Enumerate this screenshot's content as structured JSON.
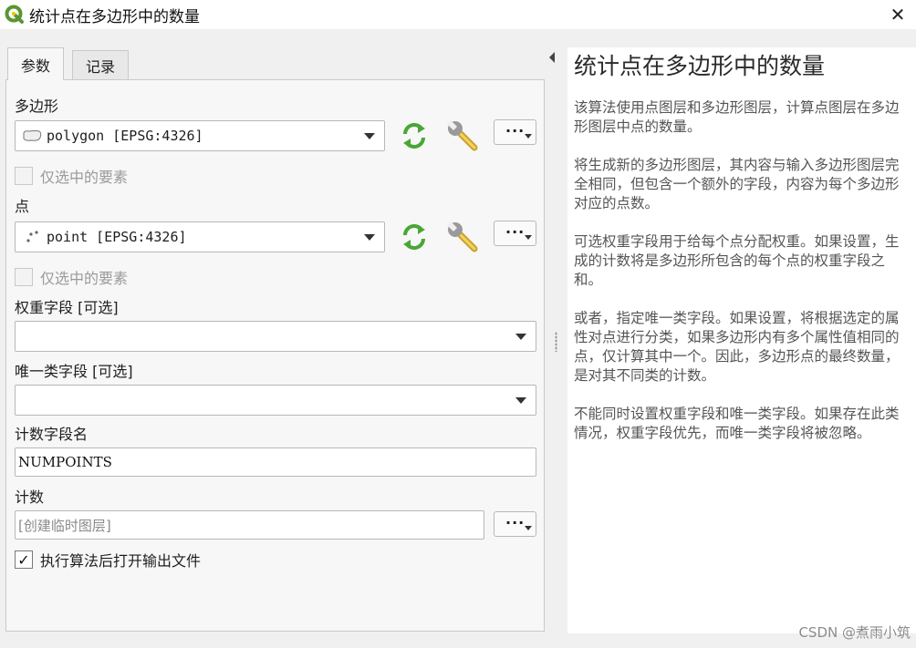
{
  "window": {
    "title": "统计点在多边形中的数量",
    "close_glyph": "✕"
  },
  "tabs": [
    {
      "label": "参数",
      "active": true
    },
    {
      "label": "记录",
      "active": false
    }
  ],
  "params": {
    "polygon_label": "多边形",
    "polygon_layer": "polygon [EPSG:4326]",
    "polygon_selected_only": {
      "label": "仅选中的要素",
      "checked": false
    },
    "point_label": "点",
    "point_layer": "point [EPSG:4326]",
    "point_selected_only": {
      "label": "仅选中的要素",
      "checked": false
    },
    "weight_label": "权重字段 [可选]",
    "weight_value": "",
    "class_label": "唯一类字段 [可选]",
    "class_value": "",
    "field_name_label": "计数字段名",
    "field_name_value": "NUMPOINTS",
    "count_label": "计数",
    "count_value": "[创建临时图层]",
    "open_after": {
      "label": "执行算法后打开输出文件",
      "checked": true,
      "mark": "✓"
    },
    "more_glyph": "···"
  },
  "help": {
    "title": "统计点在多边形中的数量",
    "paragraphs": [
      "该算法使用点图层和多边形图层，计算点图层在多边形图层中点的数量。",
      "将生成新的多边形图层，其内容与输入多边形图层完全相同，但包含一个额外的字段，内容为每个多边形对应的点数。",
      "可选权重字段用于给每个点分配权重。如果设置，生成的计数将是多边形所包含的每个点的权重字段之和。",
      "或者，指定唯一类字段。如果设置，将根据选定的属性对点进行分类，如果多边形内有多个属性值相同的点，仅计算其中一个。因此，多边形点的最终数量，是对其不同类的计数。",
      "不能同时设置权重字段和唯一类字段。如果存在此类情况，权重字段优先，而唯一类字段将被忽略。"
    ]
  },
  "watermark": "CSDN @煮雨小筑",
  "colors": {
    "qgis_green": "#589632",
    "qgis_yellow": "#f0c419",
    "iterate_green": "#4aa636"
  }
}
